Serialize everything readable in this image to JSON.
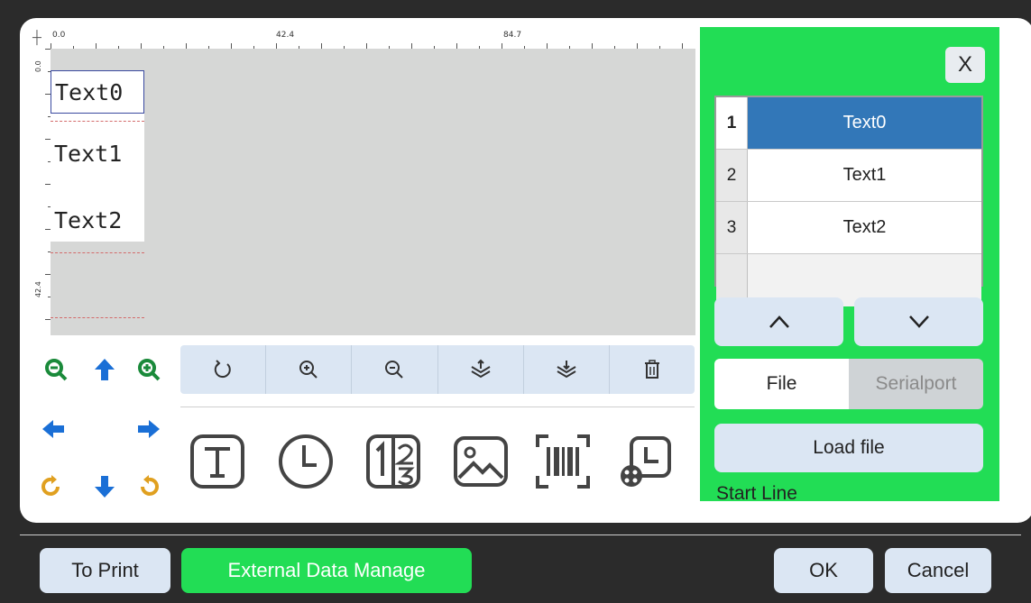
{
  "ruler": {
    "corner_label": "0.0",
    "top_labels": [
      "0.0",
      "42.4",
      "84.7"
    ],
    "left_labels": [
      "0.0",
      "42.4"
    ]
  },
  "canvas": {
    "objects": [
      {
        "label": "Text0",
        "selected": true
      },
      {
        "label": "Text1",
        "selected": false
      },
      {
        "label": "Text2",
        "selected": false
      }
    ]
  },
  "nav_icons": [
    "zoom-out-icon",
    "arrow-up-icon",
    "zoom-in-icon",
    "arrow-left-icon",
    "arrow-right-icon",
    "rotate-left-icon",
    "arrow-down-icon",
    "rotate-right-icon"
  ],
  "toolbar_icons": [
    "rotate-icon",
    "zoom-in-icon",
    "zoom-out-icon",
    "layer-up-icon",
    "layer-down-icon",
    "trash-icon"
  ],
  "insert_icons": [
    "text-tool-icon",
    "clock-tool-icon",
    "counter-tool-icon",
    "image-tool-icon",
    "barcode-tool-icon",
    "shift-clock-tool-icon"
  ],
  "right_panel": {
    "close_label": "X",
    "list": [
      {
        "index": "1",
        "value": "Text0",
        "selected": true
      },
      {
        "index": "2",
        "value": "Text1",
        "selected": false
      },
      {
        "index": "3",
        "value": "Text2",
        "selected": false
      }
    ],
    "source_tabs": {
      "file": "File",
      "serial": "Serialport",
      "active": "File"
    },
    "load_file_label": "Load file",
    "start_line_label": "Start Line"
  },
  "bottom": {
    "to_print": "To Print",
    "external_data": "External Data Manage",
    "ok": "OK",
    "cancel": "Cancel"
  },
  "colors": {
    "accent_green": "#22dd55",
    "selected_row": "#3277b8",
    "button_bg": "#dbe6f3",
    "nav_green": "#1a8a3a",
    "nav_blue": "#1a6fd6",
    "nav_orange": "#e0a020"
  }
}
